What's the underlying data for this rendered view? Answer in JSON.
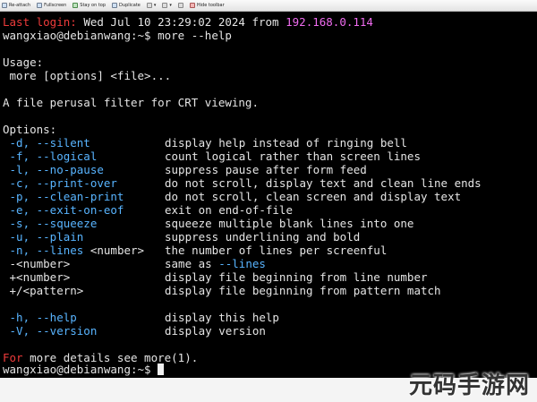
{
  "toolbar": {
    "items": [
      {
        "icon": "reattach-icon",
        "label": "Re-attach"
      },
      {
        "icon": "fullscreen-icon",
        "label": "Fullscreen"
      },
      {
        "icon": "stay-on-top-icon",
        "label": "Stay on top"
      },
      {
        "icon": "duplicate-icon",
        "label": "Duplicate"
      },
      {
        "icon": "zoom-icon",
        "label": "▾"
      },
      {
        "icon": "zoom-icon",
        "label": "▾"
      },
      {
        "icon": "refresh-icon",
        "label": ""
      },
      {
        "icon": "hide-toolbar-icon",
        "label": "Hide toolbar"
      }
    ]
  },
  "terminal": {
    "colors": {
      "background": "#000000",
      "text": "#e5e5e5",
      "red": "#ee3b3b",
      "magenta": "#f06cf0",
      "blue": "#58b4ff"
    },
    "last_login_label": "Last login:",
    "last_login_date": "Wed Jul 10 23:29:02 2024",
    "last_login_from": "from",
    "last_login_ip": "192.168.0.114",
    "prompt": "wangxiao@debianwang:~$",
    "command": "more --help",
    "usage_header": "Usage:",
    "usage_line": " more [options] <file>...",
    "description": "A file perusal filter for CRT viewing.",
    "options_header": "Options:",
    "options": [
      {
        "flag": " -d, --silent",
        "desc": "display help instead of ringing bell"
      },
      {
        "flag": " -f, --logical",
        "desc": "count logical rather than screen lines"
      },
      {
        "flag": " -l, --no-pause",
        "desc": "suppress pause after form feed"
      },
      {
        "flag": " -c, --print-over",
        "desc": "do not scroll, display text and clean line ends"
      },
      {
        "flag": " -p, --clean-print",
        "desc": "do not scroll, clean screen and display text"
      },
      {
        "flag": " -e, --exit-on-eof",
        "desc": "exit on end-of-file"
      },
      {
        "flag": " -s, --squeeze",
        "desc": "squeeze multiple blank lines into one"
      },
      {
        "flag": " -u, --plain",
        "desc": "suppress underlining and bold"
      },
      {
        "flag": " -n, --lines",
        "arg": " <number>",
        "desc": "the number of lines per screenful"
      },
      {
        "plain_flag": " -<number>",
        "desc_prefix": "same as ",
        "desc_blue": "--lines"
      },
      {
        "plain_flag": " +<number>",
        "desc": "display file beginning from line number"
      },
      {
        "plain_flag": " +/<pattern>",
        "desc": "display file beginning from pattern match"
      }
    ],
    "help_options": [
      {
        "flag": " -h, --help",
        "desc": "display this help"
      },
      {
        "flag": " -V, --version",
        "desc": "display version"
      }
    ],
    "more_details_prefix": "For",
    "more_details_rest": " more details see more(1).",
    "final_prompt": "wangxiao@debianwang:~$"
  },
  "watermark": "元码手游网"
}
